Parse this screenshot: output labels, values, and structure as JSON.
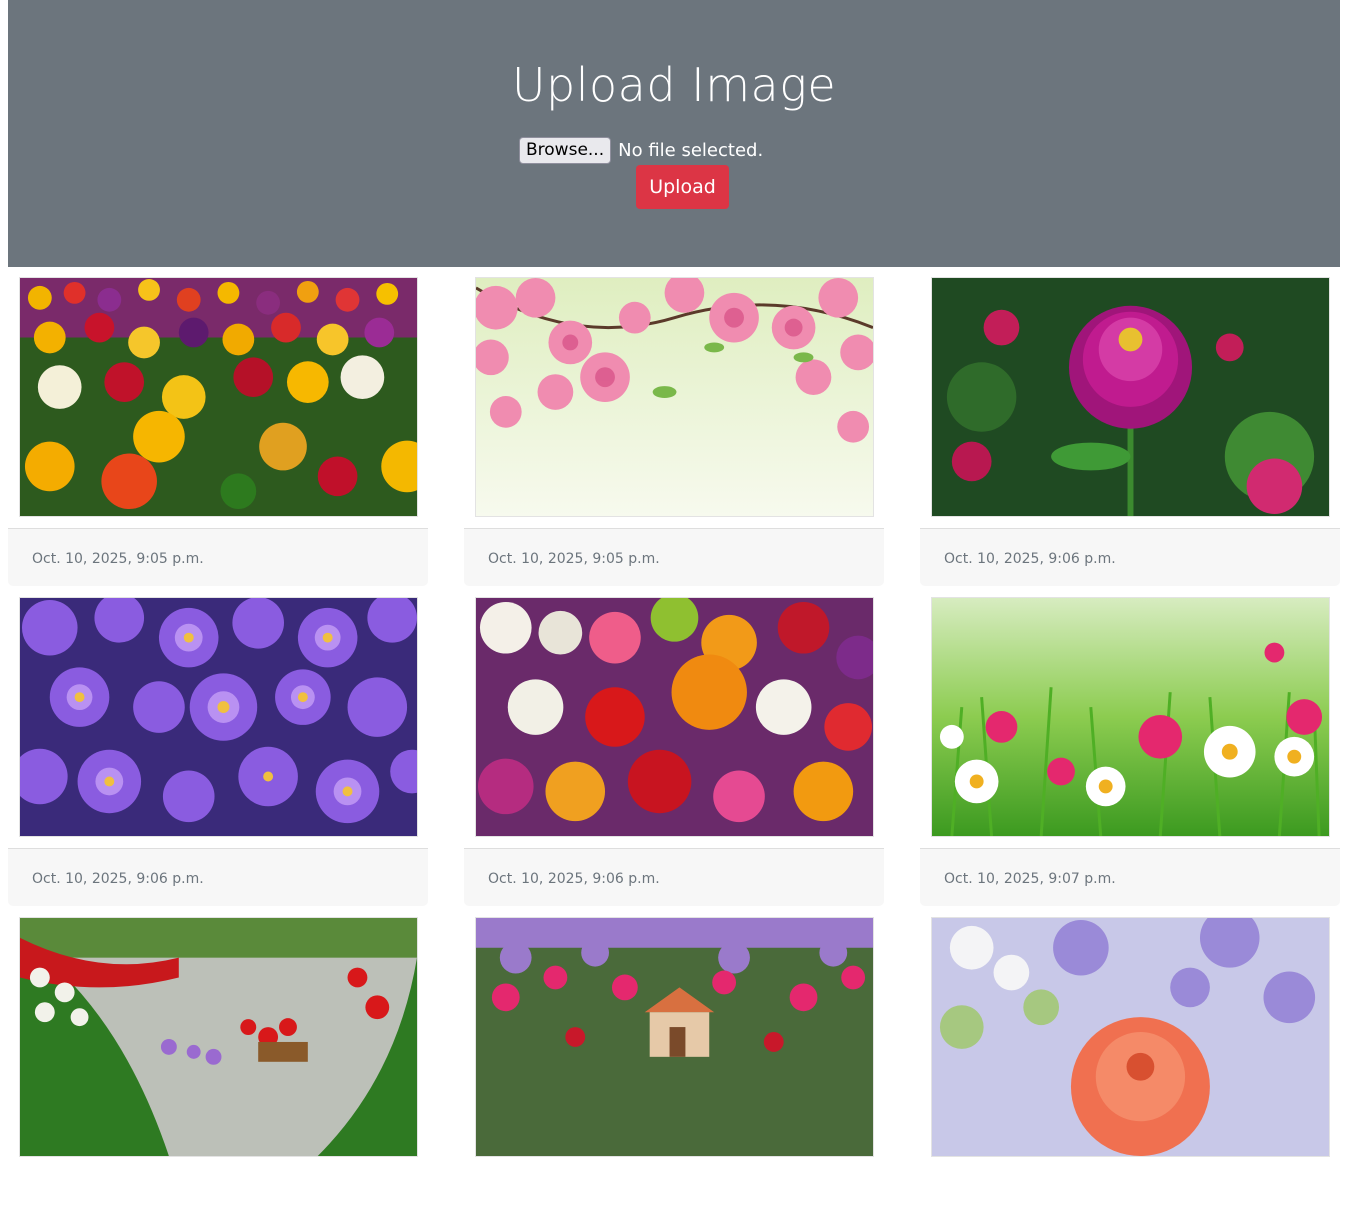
{
  "header": {
    "title": "Upload Image",
    "browse_label": "Browse...",
    "file_status": "No file selected.",
    "upload_label": "Upload",
    "background_color": "#6c757d",
    "upload_button_color": "#dc3545"
  },
  "gallery": [
    {
      "timestamp": "Oct. 10, 2025, 9:05 p.m.",
      "image": "tulips-field"
    },
    {
      "timestamp": "Oct. 10, 2025, 9:05 p.m.",
      "image": "pink-blossoms"
    },
    {
      "timestamp": "Oct. 10, 2025, 9:06 p.m.",
      "image": "magenta-zinnia"
    },
    {
      "timestamp": "Oct. 10, 2025, 9:06 p.m.",
      "image": "purple-asters"
    },
    {
      "timestamp": "Oct. 10, 2025, 9:06 p.m.",
      "image": "mixed-bouquet"
    },
    {
      "timestamp": "Oct. 10, 2025, 9:07 p.m.",
      "image": "daisy-meadow"
    },
    {
      "timestamp": "",
      "image": "flower-garden-path"
    },
    {
      "timestamp": "",
      "image": "cottage-garden"
    },
    {
      "timestamp": "",
      "image": "orange-gerbera"
    }
  ]
}
